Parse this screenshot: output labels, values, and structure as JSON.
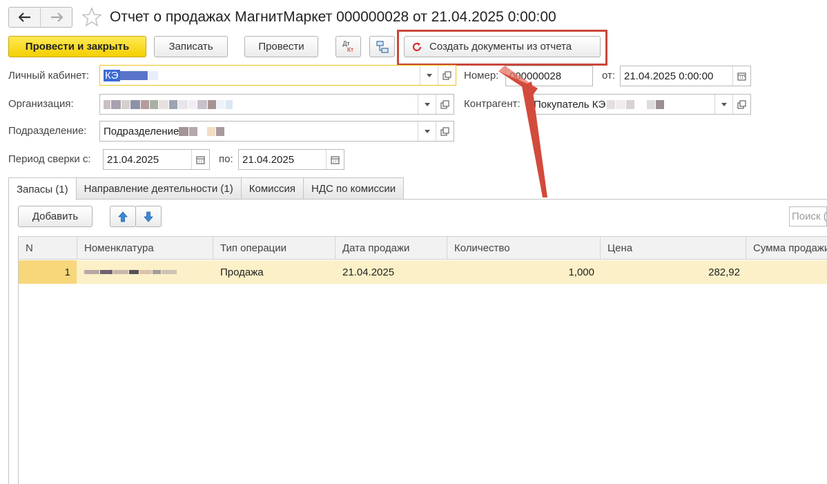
{
  "header": {
    "back_icon": "arrow-left-icon",
    "forward_icon": "arrow-right-icon",
    "favorite_icon": "star-icon",
    "title": "Отчет о продажах МагнитМаркет 000000028 от 21.04.2025 0:00:00"
  },
  "toolbar": {
    "post_close_label": "Провести и закрыть",
    "save_label": "Записать",
    "post_label": "Провести",
    "dtkt_icon": "dt-kt-icon",
    "dtkt_top": "Дт",
    "dtkt_bottom": "Кт",
    "structure_icon": "document-structure-icon",
    "create_docs_label": "Создать документы из отчета",
    "create_docs_icon": "refresh-icon"
  },
  "form": {
    "account_label": "Личный кабинет:",
    "account_value": "КЭ",
    "number_label": "Номер:",
    "number_value": "000000028",
    "date_label": "от:",
    "date_value": "21.04.2025  0:00:00",
    "org_label": "Организация:",
    "counterparty_label": "Контрагент:",
    "counterparty_value": "Покупатель КЭ",
    "division_label": "Подразделение:",
    "division_value": "Подразделение",
    "period_from_label": "Период сверки с:",
    "period_from_value": "21.04.2025",
    "period_to_label": "по:",
    "period_to_value": "21.04.2025"
  },
  "tabs": [
    {
      "label": "Запасы (1)",
      "active": true
    },
    {
      "label": "Направление деятельности (1)",
      "active": false
    },
    {
      "label": "Комиссия",
      "active": false
    },
    {
      "label": "НДС по комиссии",
      "active": false
    }
  ],
  "table_toolbar": {
    "add_label": "Добавить",
    "up_icon": "arrow-up-icon",
    "down_icon": "arrow-down-icon",
    "search_placeholder": "Поиск (Ctrl+F)"
  },
  "table": {
    "columns": [
      "N",
      "Номенклатура",
      "Тип операции",
      "Дата продажи",
      "Количество",
      "Цена",
      "Сумма продажи"
    ],
    "rows": [
      {
        "n": "1",
        "nomenclature": "",
        "operation": "Продажа",
        "date": "21.04.2025",
        "quantity": "1,000",
        "price": "282,92",
        "sum": ""
      }
    ]
  },
  "colors": {
    "primary_button": "#f5cf00",
    "highlight_box": "#c8473b",
    "annotation_arrow": "#d24b3c",
    "selected_row": "#fbf0c7"
  }
}
